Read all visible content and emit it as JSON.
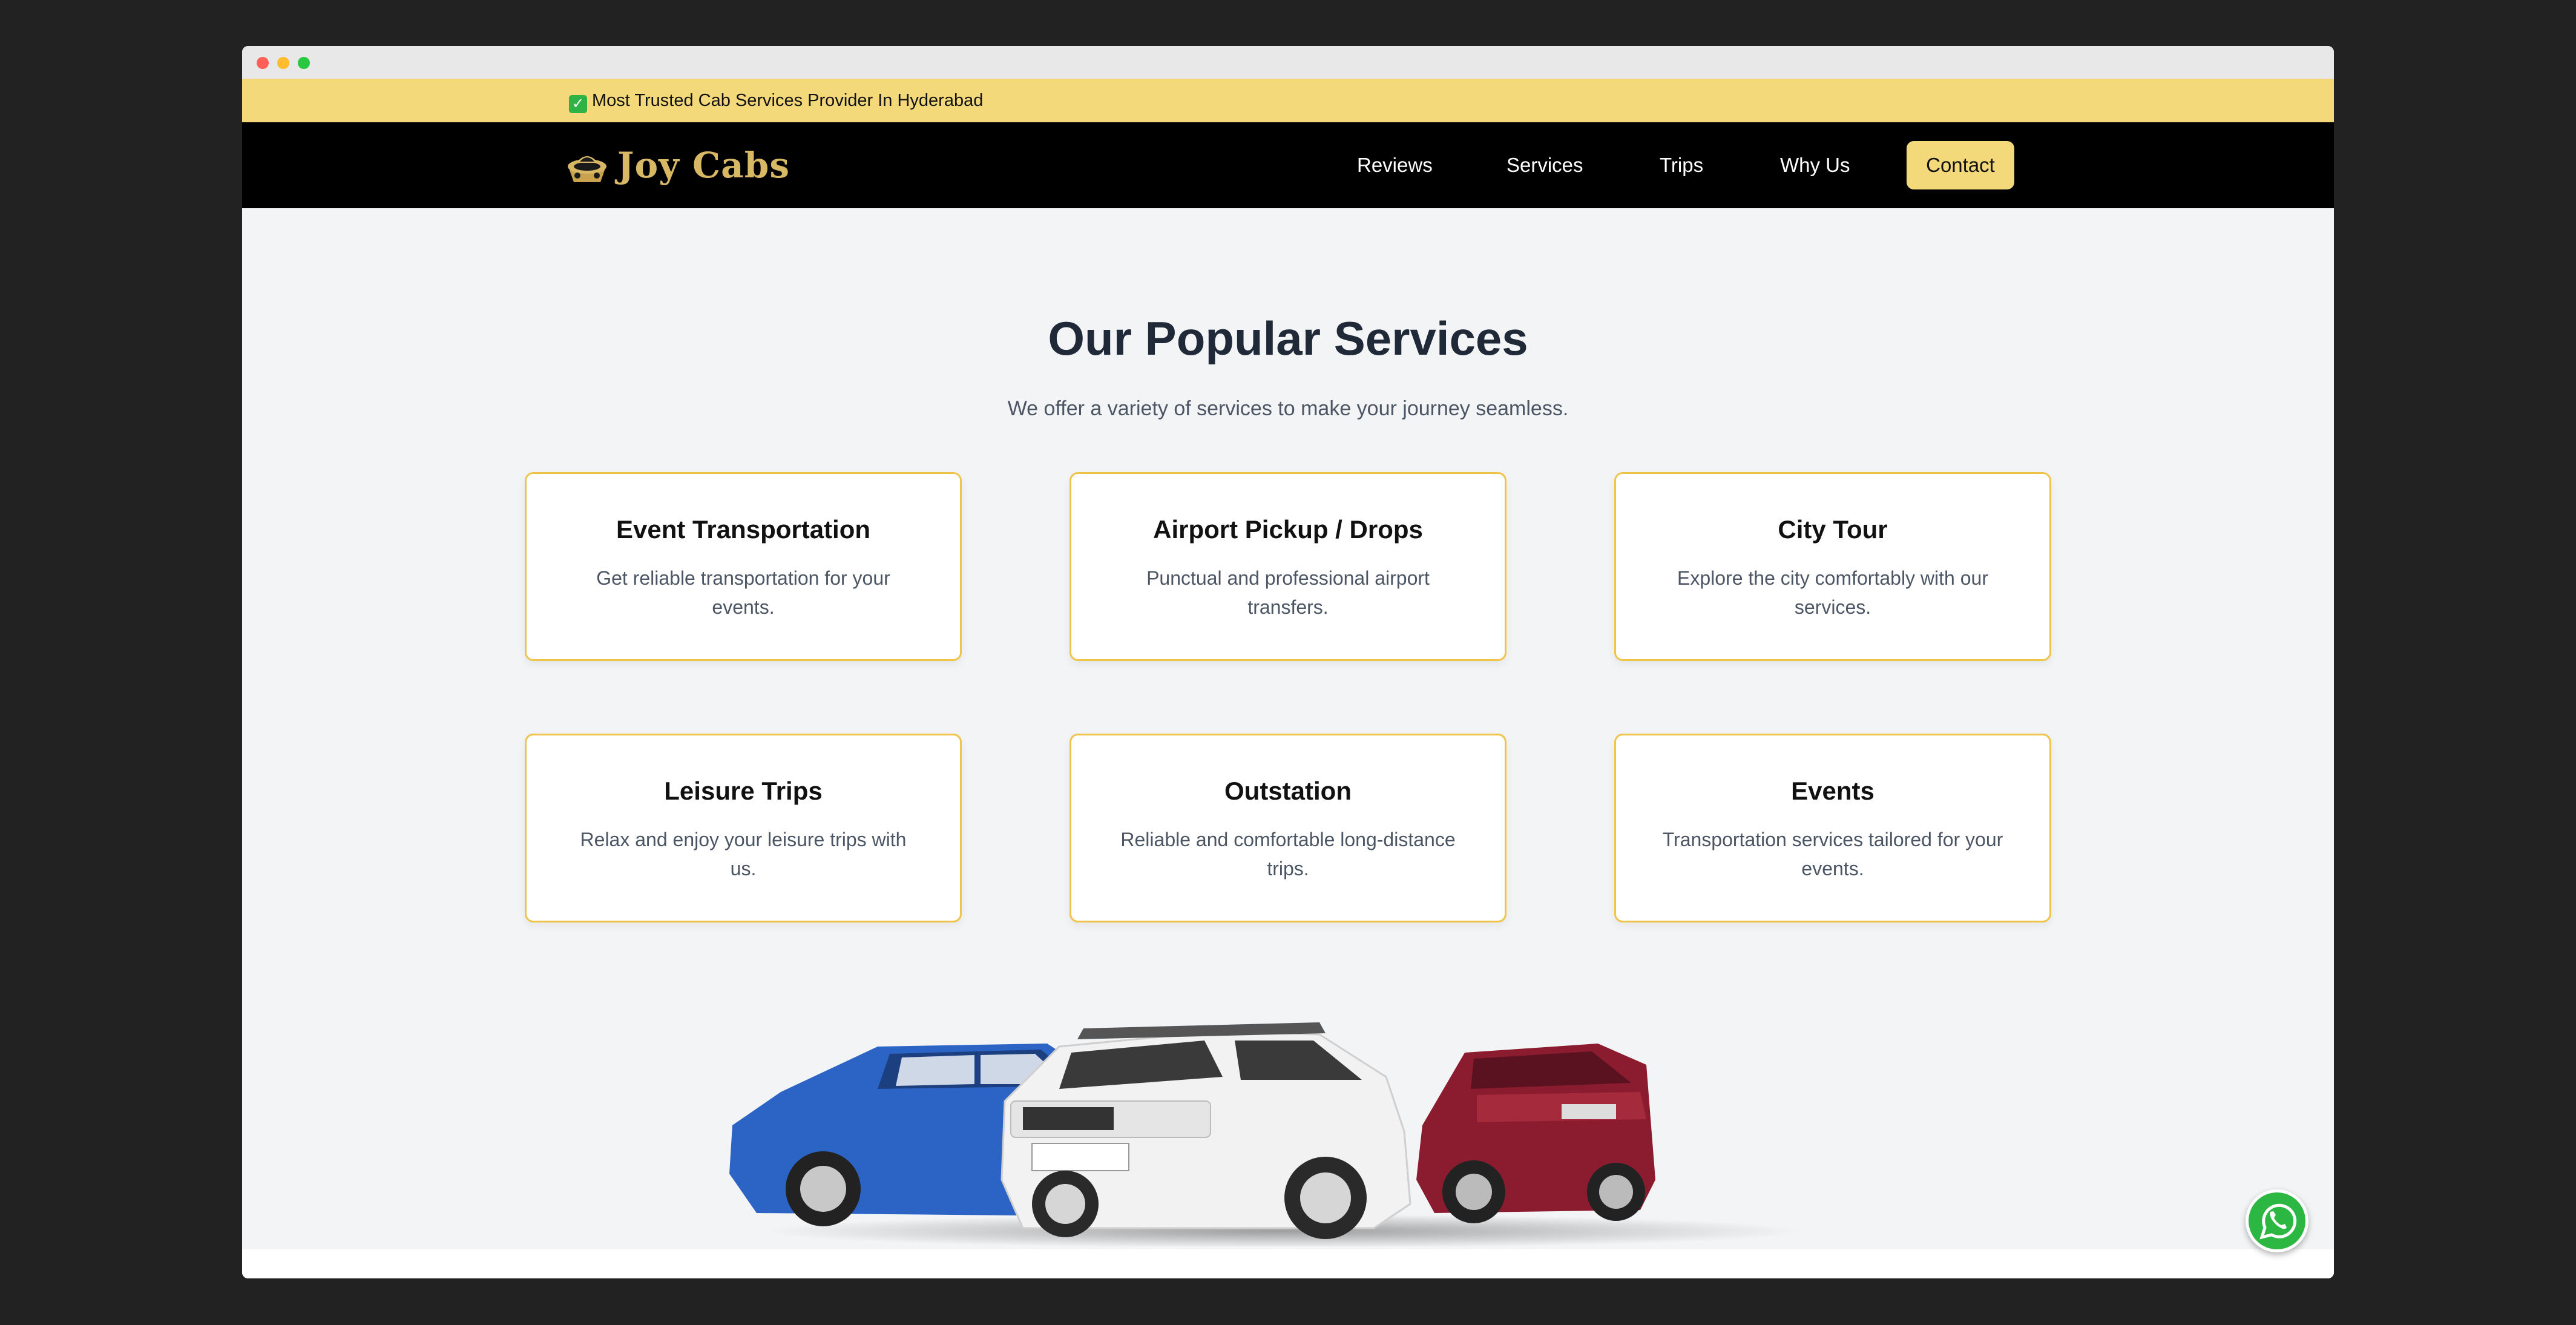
{
  "topbar": {
    "text": "Most Trusted Cab Services Provider In Hyderabad"
  },
  "brand": {
    "name": "Joy Cabs"
  },
  "nav": {
    "links": [
      "Reviews",
      "Services",
      "Trips",
      "Why Us"
    ],
    "contact_label": "Contact"
  },
  "services": {
    "title": "Our Popular Services",
    "subtitle": "We offer a variety of services to make your journey seamless.",
    "cards": [
      {
        "title": "Event Transportation",
        "desc": "Get reliable transportation for your events."
      },
      {
        "title": "Airport Pickup / Drops",
        "desc": "Punctual and professional airport transfers."
      },
      {
        "title": "City Tour",
        "desc": "Explore the city comfortably with our services."
      },
      {
        "title": "Leisure Trips",
        "desc": "Relax and enjoy your leisure trips with us."
      },
      {
        "title": "Outstation",
        "desc": "Reliable and comfortable long-distance trips."
      },
      {
        "title": "Events",
        "desc": "Transportation services tailored for your events."
      }
    ]
  },
  "colors": {
    "accent_yellow": "#f4d97b",
    "card_border": "#f0c44a",
    "navbar_bg": "#000000",
    "logo_gold": "#d8b765",
    "whatsapp_green": "#2bb741"
  },
  "icons": {
    "check": "check-mark-icon",
    "logo": "cab-logo-icon",
    "whatsapp": "whatsapp-icon"
  }
}
